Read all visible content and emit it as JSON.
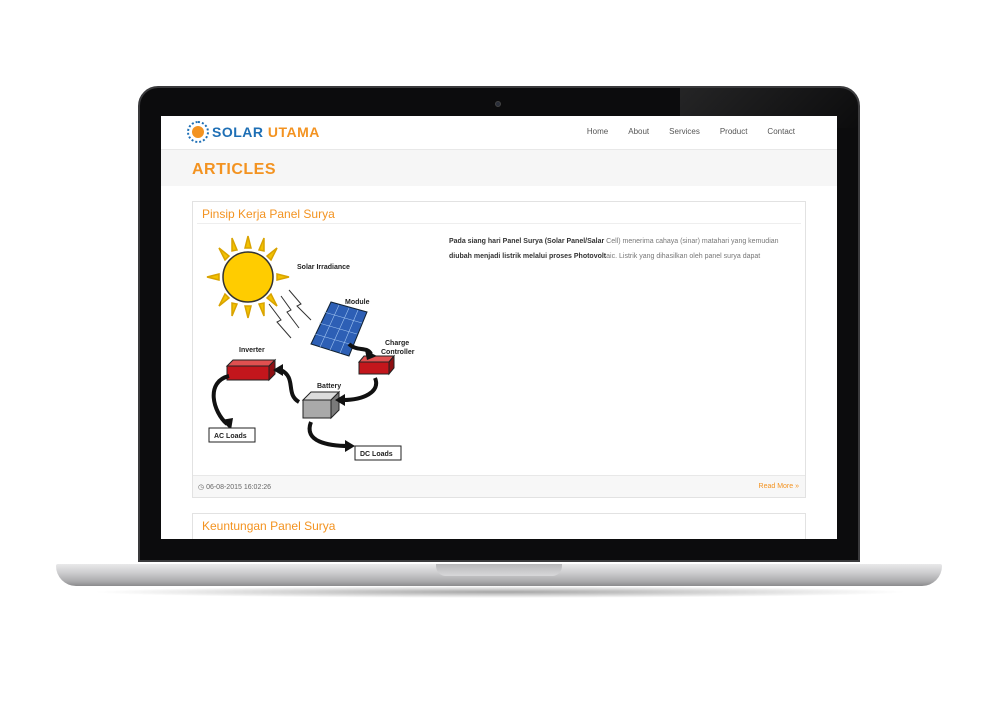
{
  "header": {
    "logo_part1": "SOLAR",
    "logo_part2": "UTAMA",
    "nav": [
      "Home",
      "About",
      "Services",
      "Product",
      "Contact"
    ]
  },
  "band": {
    "title": "ARTICLES"
  },
  "articles": [
    {
      "title": "Pinsip Kerja Panel Surya",
      "excerpt_parts": [
        "Pada siang hari Panel Surya (Solar Panel/Salar",
        " Cell) menerima cahaya (sinar) matahari yang kemudian ",
        "diubah menjadi listrik melalui proses Photovolt",
        "aic. Listrik yang dihasilkan oleh panel surya dapat"
      ],
      "figure_labels": {
        "irradiance": "Solar Irradiance",
        "module": "Module",
        "charge_controller_1": "Charge",
        "charge_controller_2": "Controller",
        "inverter": "Inverter",
        "battery": "Battery",
        "ac_loads": "AC Loads",
        "dc_loads": "DC Loads"
      },
      "date": "06-08-2015 16:02:26",
      "read_more": "Read More »"
    },
    {
      "title": "Keuntungan Panel Surya"
    }
  ],
  "colors": {
    "accent": "#f39321",
    "brand_blue": "#1e6fb5"
  },
  "icons": {
    "date": "clock-icon"
  }
}
